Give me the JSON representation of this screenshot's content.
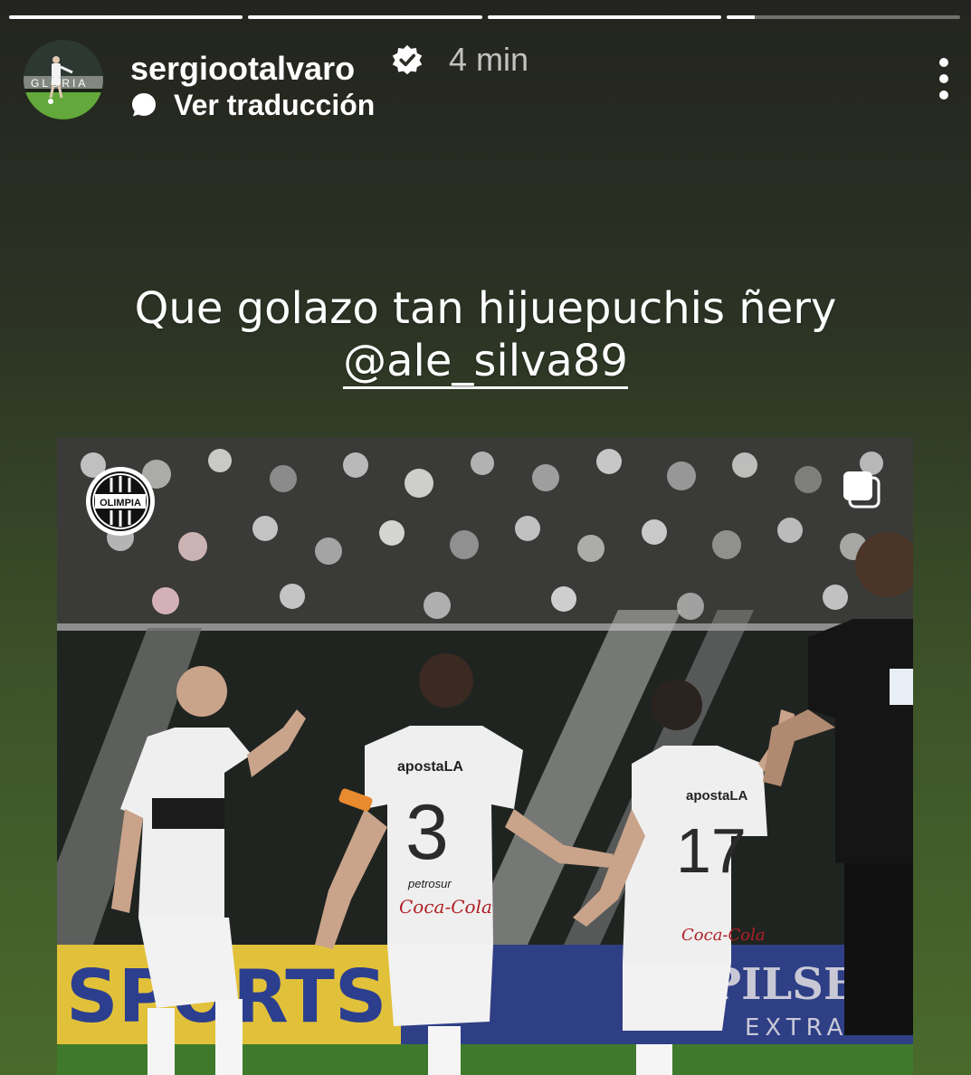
{
  "progress": [
    1,
    1,
    1,
    0.12
  ],
  "user": {
    "username": "sergiootalvaro",
    "time": "4 min",
    "verified_icon": "verified-badge-icon",
    "avatar_text": "GLORIA"
  },
  "translate": {
    "label": "Ver traducción",
    "icon": "speech-bubble-icon"
  },
  "menu_icon": "more-vertical-icon",
  "caption": {
    "line1": "Que golazo tan hijuepuchis ñery",
    "mention": "@ale_silva89"
  },
  "post": {
    "logo_text": "OLIMPIA",
    "carousel_icon": "multiple-posts-icon",
    "jersey_sponsor": "apostaLA",
    "jersey_sponsor2": "Coca-Cola",
    "jersey_sponsor3": "petrosur",
    "numbers": [
      "3",
      "17"
    ],
    "banner_left": "SPORTS",
    "banner_right": "PILSEN",
    "banner_right_sub": "EXTRA",
    "colors": {
      "jersey": "#efefef",
      "referee": "#151515",
      "pitch": "#3f7a2c",
      "banner_yellow": "#e3c23b",
      "banner_blue": "#2c3f8f"
    }
  }
}
